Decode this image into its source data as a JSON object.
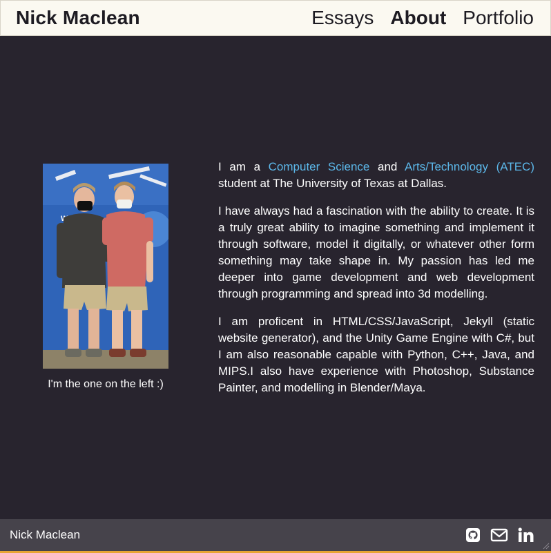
{
  "header": {
    "site_title": "Nick Maclean",
    "nav": [
      {
        "label": "Essays",
        "active": false
      },
      {
        "label": "About",
        "active": true
      },
      {
        "label": "Portfolio",
        "active": false
      }
    ]
  },
  "photo": {
    "caption": "I'm the one on the left :)",
    "background_sign_text": "Wal"
  },
  "bio": {
    "p1": {
      "t1": "I am a ",
      "link1": "Computer Science",
      "t2": " and ",
      "link2": "Arts/Technology (ATEC)",
      "t3": " student at The University of Texas at Dallas."
    },
    "p2": "I have always had a fascination with the ability to create. It is a truly great ability to imagine something and implement it through software, model it digitally, or whatever other form something may take shape in. My passion has led me deeper into game development and web development through programming and spread into 3d modelling.",
    "p3": "I am proficent in HTML/CSS/JavaScript, Jekyll (static website generator), and the Unity Game Engine with C#, but I am also reasonable capable with Python, C++, Java, and MIPS.I also have experience with Photoshop, Substance Painter, and modelling in Blender/Maya."
  },
  "footer": {
    "name": "Nick Maclean",
    "icons": [
      "github-icon",
      "email-icon",
      "linkedin-icon"
    ]
  },
  "colors": {
    "background": "#28242e",
    "header": "#fbf9f1",
    "link": "#5cb8ea",
    "footer": "#46434b",
    "footer_accent": "#e7a535"
  }
}
